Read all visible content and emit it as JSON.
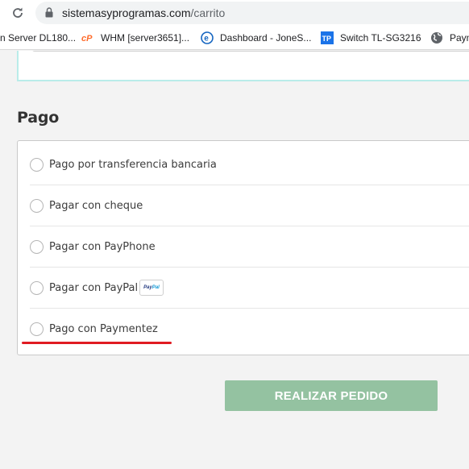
{
  "browser": {
    "url_host": "sistemasyprogramas.com",
    "url_path": "/carrito",
    "bookmarks": [
      {
        "label": "n Server DL180...",
        "icon": "none"
      },
      {
        "label": "WHM [server3651]...",
        "icon": "cpanel-icon"
      },
      {
        "label": "Dashboard - JoneS...",
        "icon": "e-icon"
      },
      {
        "label": "Switch TL-SG3216",
        "icon": "tplink-icon"
      },
      {
        "label": "Paym",
        "icon": "globe-icon"
      }
    ]
  },
  "payment": {
    "title": "Pago",
    "options": [
      {
        "label": "Pago por transferencia bancaria",
        "selected": false
      },
      {
        "label": "Pagar con cheque",
        "selected": false
      },
      {
        "label": "Pagar con PayPhone",
        "selected": false
      },
      {
        "label": "Pagar con PayPal",
        "selected": false,
        "badge": {
          "part1": "Pay",
          "part2": "Pal"
        }
      },
      {
        "label": "Pago con Paymentez",
        "selected": false
      }
    ]
  },
  "actions": {
    "place_order": "REALIZAR PEDIDO"
  },
  "colors": {
    "accent_border": "#b9ece9",
    "button_bg": "#94c2a1",
    "annotation_red": "#e01b22"
  }
}
